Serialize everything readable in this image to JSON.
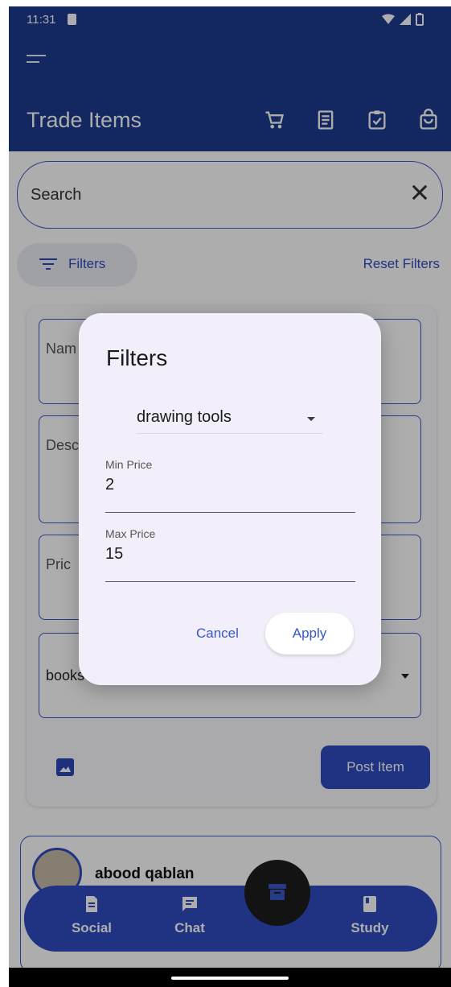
{
  "status_bar": {
    "time": "11:31"
  },
  "app_bar": {
    "title": "Trade Items",
    "actions": [
      "cart-icon",
      "receipt-icon",
      "clipboard-check-icon",
      "shopping-bag-icon"
    ]
  },
  "search": {
    "placeholder": "Search"
  },
  "filters": {
    "chip_label": "Filters",
    "reset_label": "Reset Filters"
  },
  "post_form": {
    "name_label": "Nam",
    "desc_label": "Desc",
    "price_label": "Pric",
    "category_value": "books",
    "post_button": "Post Item"
  },
  "feed": {
    "author": "abood qablan"
  },
  "bottom_nav": {
    "social": "Social",
    "chat": "Chat",
    "study": "Study"
  },
  "dialog": {
    "title": "Filters",
    "category": "drawing tools",
    "min_label": "Min Price",
    "min_value": "2",
    "max_label": "Max Price",
    "max_value": "15",
    "cancel": "Cancel",
    "apply": "Apply"
  },
  "colors": {
    "primary": "#1c3b8f",
    "accent": "#2f4cc0",
    "dialog_bg": "#f2effa"
  }
}
